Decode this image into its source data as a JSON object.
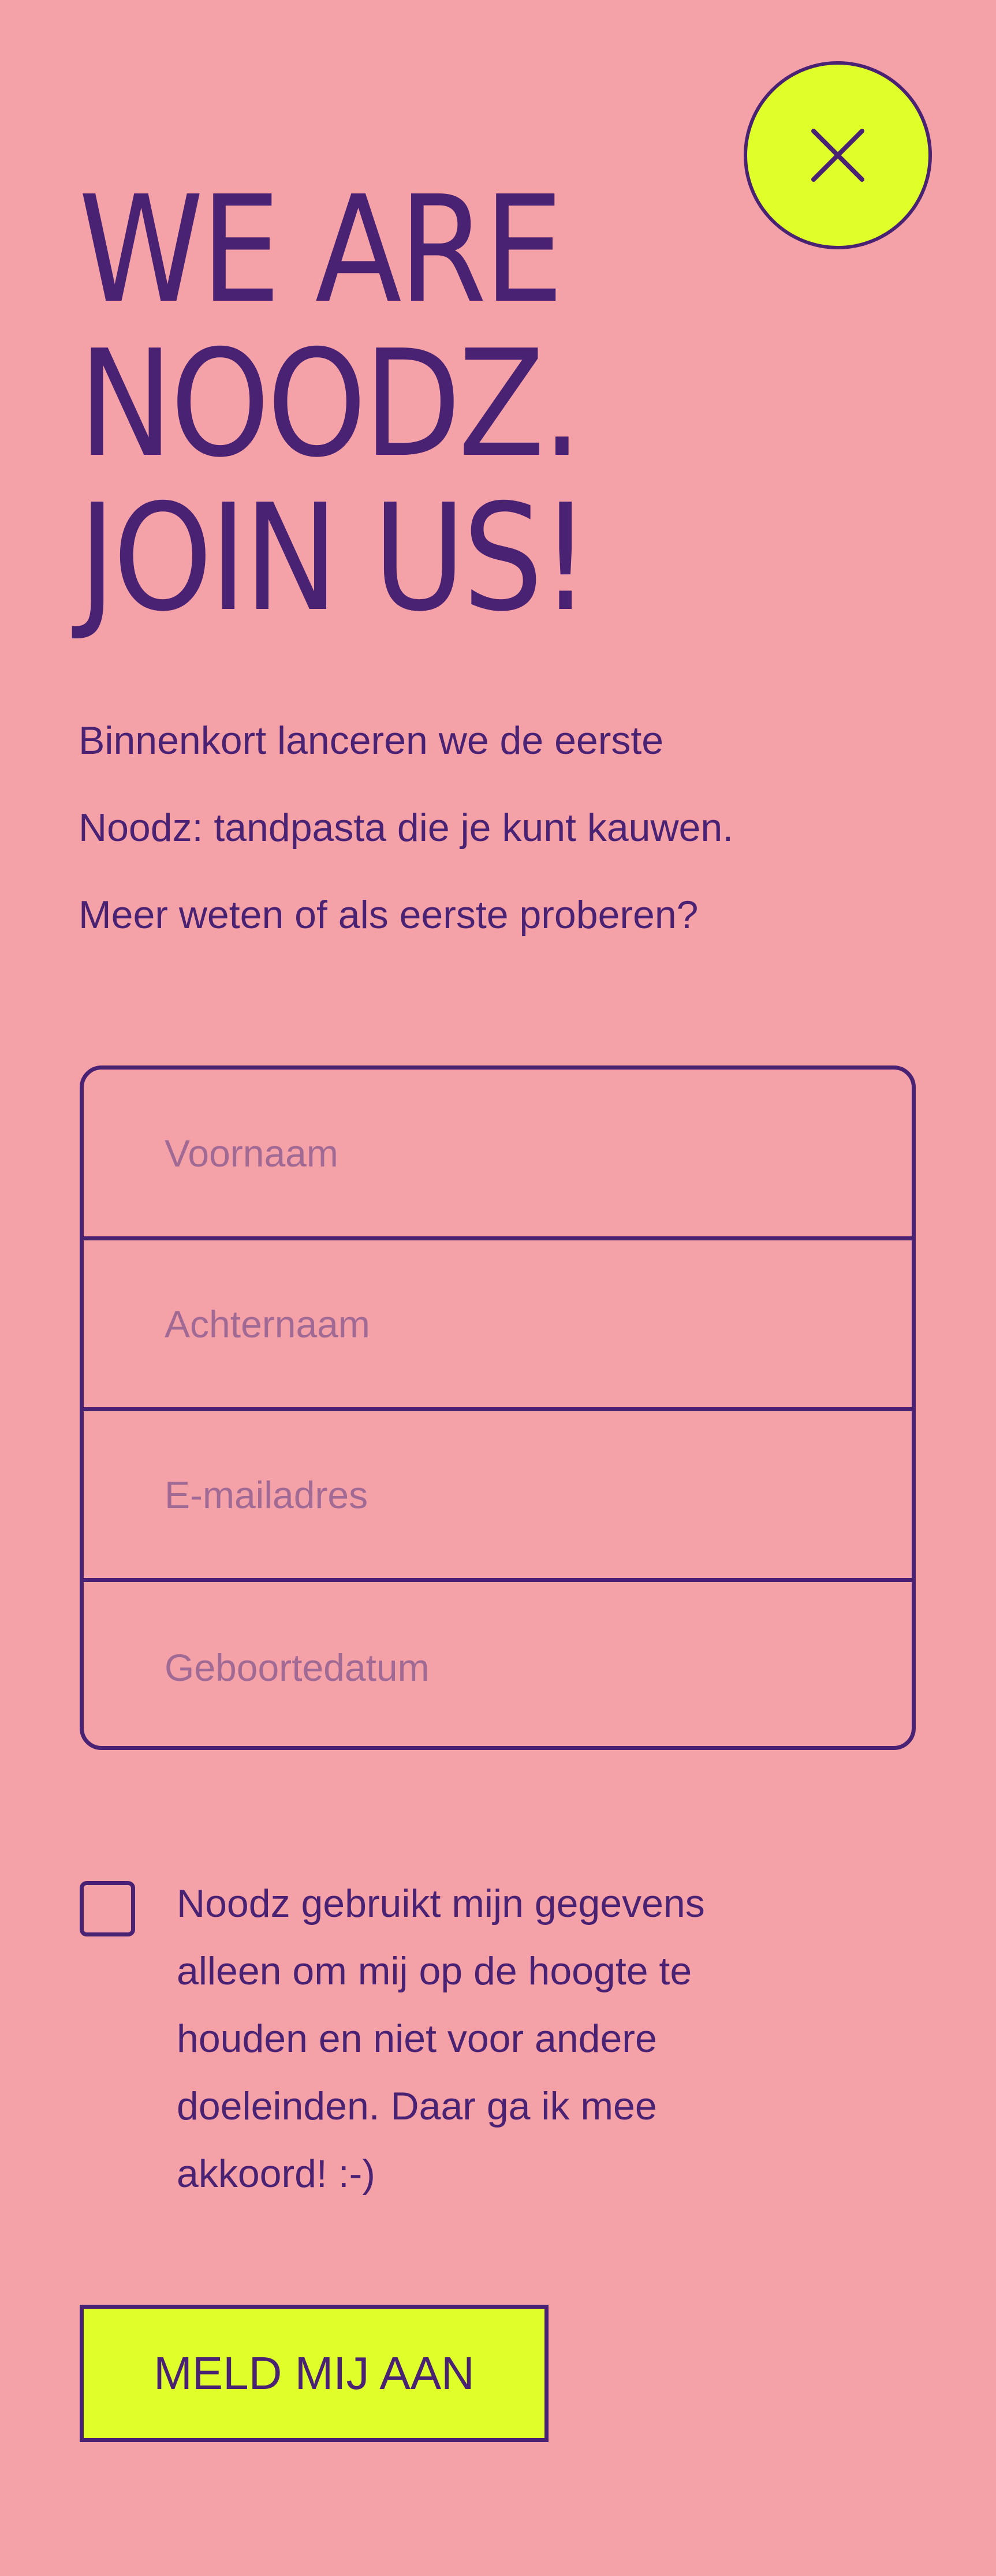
{
  "close_button": {
    "icon": "close-icon"
  },
  "headline": {
    "line1": "WE ARE",
    "line2": "NOODZ.",
    "line3": "JOIN US!"
  },
  "intro": {
    "line1": "Binnenkort lanceren we de eerste",
    "line2": "Noodz: tandpasta die je kunt kauwen.",
    "line3": "Meer weten of als eerste proberen?"
  },
  "form": {
    "first_name_placeholder": "Voornaam",
    "last_name_placeholder": "Achternaam",
    "email_placeholder": "E-mailadres",
    "birthdate_placeholder": "Geboortedatum"
  },
  "consent": {
    "checked": false,
    "line1": "Noodz gebruikt mijn gegevens",
    "line2": "alleen om mij op de hoogte te",
    "line3": "houden en niet voor andere",
    "line4": "doeleinden. Daar ga ik mee",
    "line5": "akkoord! :-)"
  },
  "submit": {
    "label": "MELD MIJ AAN"
  },
  "colors": {
    "background": "#f5a1a8",
    "ink": "#4a2273",
    "accent": "#e0ff2a",
    "placeholder": "#a06a95"
  }
}
